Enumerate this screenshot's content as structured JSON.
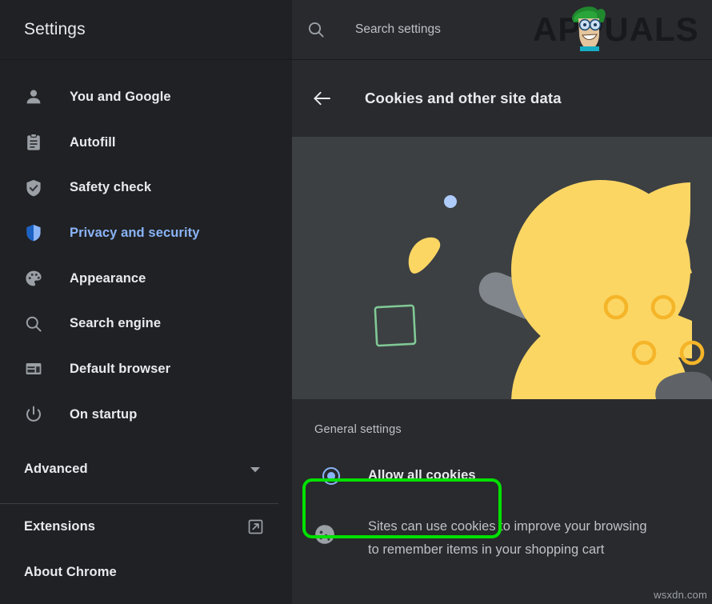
{
  "app": {
    "title": "Settings"
  },
  "search": {
    "placeholder": "Search settings",
    "value": "",
    "icon": "search-icon"
  },
  "brand": {
    "name": "APPUALS",
    "colors": {
      "cap": "#1f8a2f",
      "text": "#1c1d20",
      "skin": "#e8c9a0"
    }
  },
  "sidebar": {
    "items": [
      {
        "label": "You and Google",
        "icon": "person-icon",
        "selected": false
      },
      {
        "label": "Autofill",
        "icon": "clipboard-icon",
        "selected": false
      },
      {
        "label": "Safety check",
        "icon": "shield-check-icon",
        "selected": false
      },
      {
        "label": "Privacy and security",
        "icon": "shield-icon",
        "selected": true
      },
      {
        "label": "Appearance",
        "icon": "palette-icon",
        "selected": false
      },
      {
        "label": "Search engine",
        "icon": "search-icon",
        "selected": false
      },
      {
        "label": "Default browser",
        "icon": "browser-window-icon",
        "selected": false
      },
      {
        "label": "On startup",
        "icon": "power-icon",
        "selected": false
      }
    ],
    "advanced": {
      "label": "Advanced",
      "icon": "chevron-down-icon"
    },
    "footer": [
      {
        "label": "Extensions",
        "icon": "external-link-icon"
      },
      {
        "label": "About Chrome",
        "icon": null
      }
    ],
    "selected_color": "#8ab4f8"
  },
  "main": {
    "back_icon": "arrow-left-icon",
    "page_title": "Cookies and other site data",
    "banner": {
      "name": "cookie-illustration",
      "background": "#3c4043",
      "cookie_color": "#fcd663",
      "cookie_hole_color": "#f5b529",
      "blue_dot_color": "#aecbfa",
      "green_square_color": "#81c995",
      "grey_pill_color": "#80868b"
    },
    "section_title": "General settings",
    "options": [
      {
        "label": "Allow all cookies",
        "selected": true,
        "highlighted": true,
        "highlight_color": "#00e000",
        "radio_color": "#8ab4f8",
        "description_icon": "cookie-icon",
        "description_lines": [
          "Sites can use cookies to improve your browsing",
          "to remember items in your shopping cart"
        ]
      }
    ]
  },
  "watermark": {
    "text": "wsxdn.com"
  }
}
